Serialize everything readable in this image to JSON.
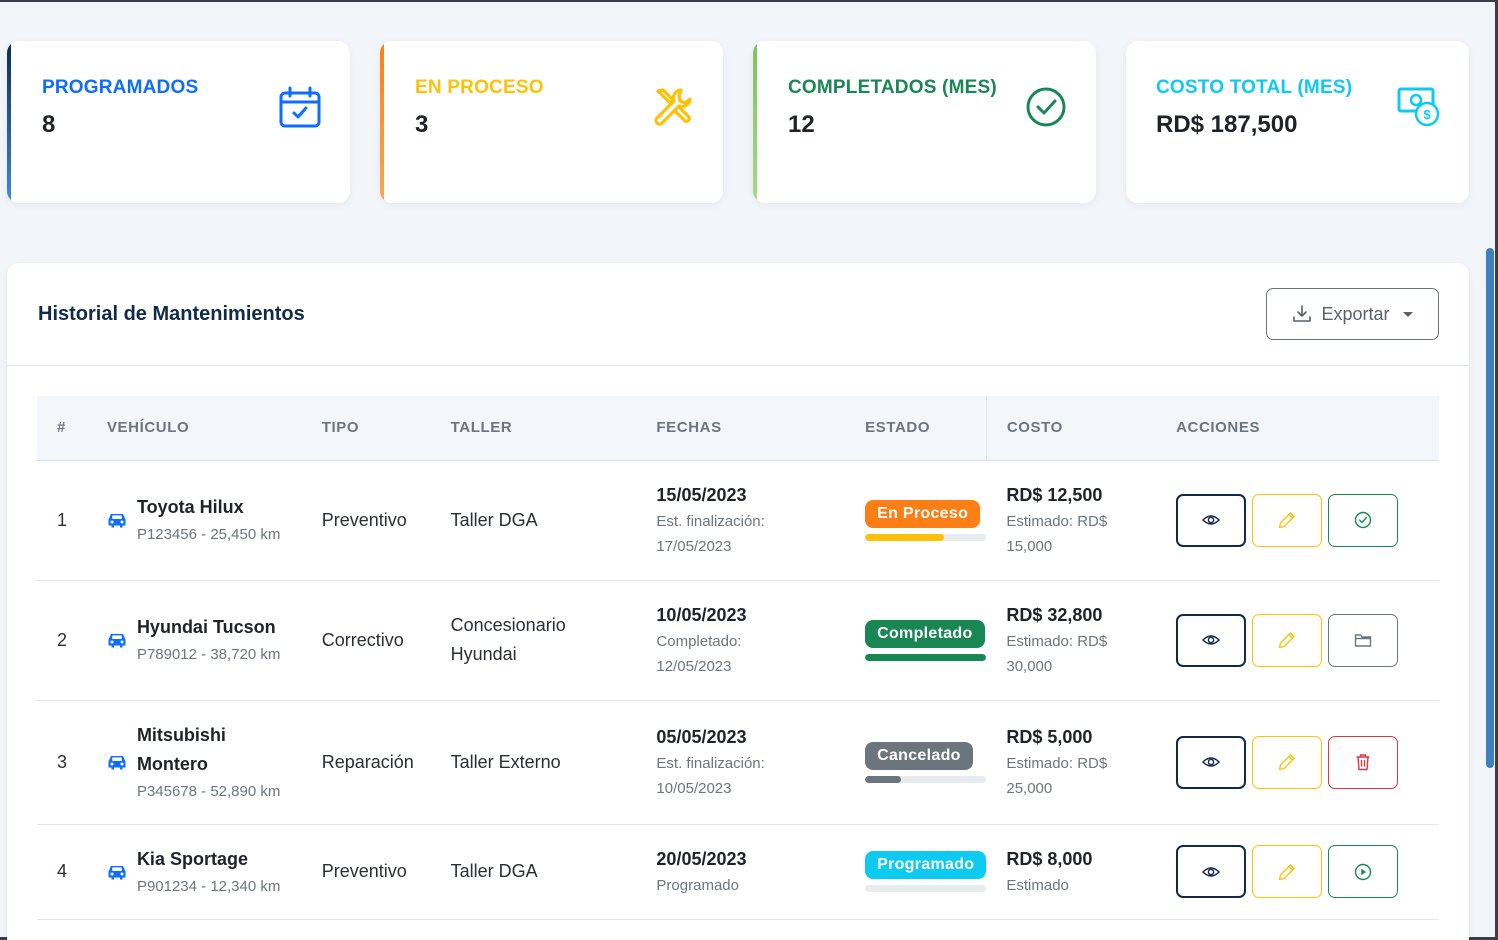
{
  "stats": [
    {
      "label": "PROGRAMADOS",
      "value": "8",
      "color": "#0d6efd",
      "icon": "calendar-check-icon"
    },
    {
      "label": "EN PROCESO",
      "value": "3",
      "color": "#ffc107",
      "icon": "tools-icon"
    },
    {
      "label": "COMPLETADOS (MES)",
      "value": "12",
      "color": "#198754",
      "icon": "check-circle-icon"
    },
    {
      "label": "COSTO TOTAL (MES)",
      "value": "RD$ 187,500",
      "color": "#0dcaf0",
      "icon": "cash-coin-icon"
    }
  ],
  "history": {
    "title": "Historial de Mantenimientos",
    "export_label": "Exportar",
    "columns": [
      "#",
      "VEHÍCULO",
      "TIPO",
      "TALLER",
      "FECHAS",
      "ESTADO",
      "COSTO",
      "ACCIONES"
    ],
    "rows": [
      {
        "num": "1",
        "vehicle_lines": [
          "Toyota Hilux"
        ],
        "plate": "P123456 - 25,450 km",
        "type": "Preventivo",
        "shop_lines": [
          "Taller DGA"
        ],
        "date": "15/05/2023",
        "date_sub_lines": [
          "Est. finalización:",
          "17/05/2023"
        ],
        "status": "En Proceso",
        "status_color": "#fd7e14",
        "progress": 0.65,
        "progress_color": "#ffc107",
        "cost": "RD$ 12,500",
        "cost_sub_lines": [
          "Estimado: RD$",
          "15,000"
        ],
        "third_action": "check-circle-icon"
      },
      {
        "num": "2",
        "vehicle_lines": [
          "Hyundai Tucson"
        ],
        "plate": "P789012 - 38,720 km",
        "type": "Correctivo",
        "shop_lines": [
          "Concesionario",
          "Hyundai"
        ],
        "date": "10/05/2023",
        "date_sub_lines": [
          "Completado:",
          "12/05/2023"
        ],
        "status": "Completado",
        "status_color": "#198754",
        "progress": 1.0,
        "progress_color": "#198754",
        "cost": "RD$ 32,800",
        "cost_sub_lines": [
          "Estimado: RD$",
          "30,000"
        ],
        "third_action": "folder-icon"
      },
      {
        "num": "3",
        "vehicle_lines": [
          "Mitsubishi",
          "Montero"
        ],
        "plate": "P345678 - 52,890 km",
        "type": "Reparación",
        "shop_lines": [
          "Taller Externo"
        ],
        "date": "05/05/2023",
        "date_sub_lines": [
          "Est. finalización:",
          "10/05/2023"
        ],
        "status": "Cancelado",
        "status_color": "#6c757d",
        "progress": 0.3,
        "progress_color": "#6c757d",
        "cost": "RD$ 5,000",
        "cost_sub_lines": [
          "Estimado: RD$",
          "25,000"
        ],
        "third_action": "trash-icon"
      },
      {
        "num": "4",
        "vehicle_lines": [
          "Kia Sportage"
        ],
        "plate": "P901234 - 12,340 km",
        "type": "Preventivo",
        "shop_lines": [
          "Taller DGA"
        ],
        "date": "20/05/2023",
        "date_sub_lines": [
          "Programado"
        ],
        "status": "Programado",
        "status_color": "#0dcaf0",
        "progress": 0.0,
        "progress_color": "#0dcaf0",
        "cost": "RD$ 8,000",
        "cost_sub_lines": [
          "Estimado"
        ],
        "third_action": "play-circle-icon"
      }
    ]
  }
}
